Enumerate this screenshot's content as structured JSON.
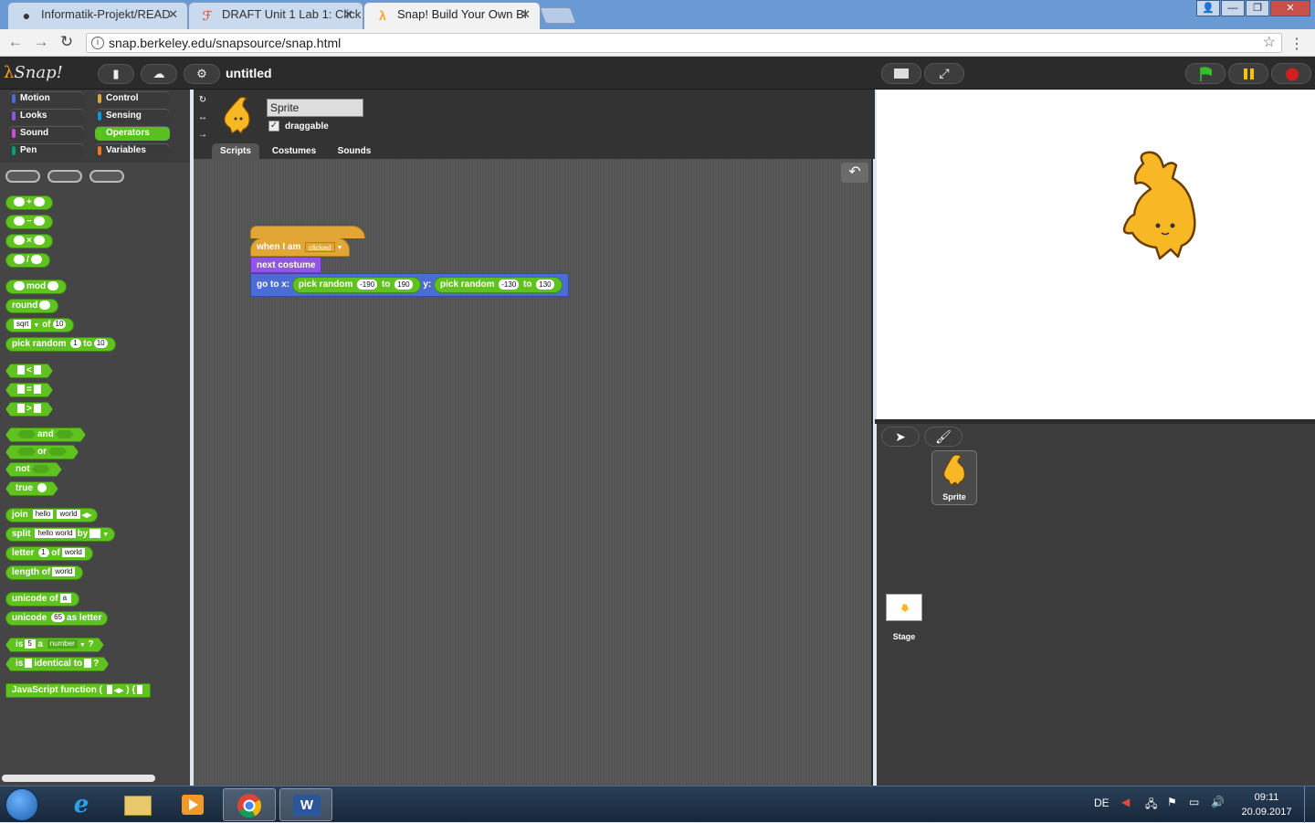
{
  "browser": {
    "tabs": [
      {
        "label": "Informatik-Projekt/READ",
        "icon": "github-icon",
        "active": false
      },
      {
        "label": "DRAFT Unit 1 Lab 1: Click",
        "icon": "bjc-icon",
        "active": false
      },
      {
        "label": "Snap! Build Your Own Bl",
        "icon": "snap-lambda-icon",
        "active": true
      }
    ],
    "url": "snap.berkeley.edu/snapsource/snap.html"
  },
  "snap": {
    "logo": "Snap!",
    "project_title": "untitled",
    "categories": [
      {
        "label": "Motion",
        "color": "#4a6cd4"
      },
      {
        "label": "Control",
        "color": "#e2a634"
      },
      {
        "label": "Looks",
        "color": "#8f56e3"
      },
      {
        "label": "Sensing",
        "color": "#0494dc"
      },
      {
        "label": "Sound",
        "color": "#cf4ad9"
      },
      {
        "label": "Operators",
        "color": "#5fc21e"
      },
      {
        "label": "Pen",
        "color": "#00a178"
      },
      {
        "label": "Variables",
        "color": "#f3761d"
      }
    ],
    "selected_category": "Operators",
    "palette": {
      "plus": "+",
      "minus": "−",
      "times": "×",
      "divide": "/",
      "mod": "mod",
      "round": "round",
      "sqrt_fn": "sqrt",
      "of": "of",
      "sqrt_val": "10",
      "pick_random": "pick random",
      "to": "to",
      "rand_from": "1",
      "rand_to": "10",
      "lt": "<",
      "eq": "=",
      "gt": ">",
      "and": "and",
      "or": "or",
      "not": "not",
      "true": "true",
      "join": "join",
      "join_a": "hello ",
      "join_b": "world",
      "split": "split",
      "split_val": "hello world",
      "by": "by",
      "split_by": " ",
      "letter": "letter",
      "letter_n": "1",
      "letter_of": "of",
      "letter_word": "world",
      "length": "length",
      "length_of": "of",
      "length_word": "world",
      "unicode_of": "unicode of",
      "unicode_of_val": "a",
      "unicode": "unicode",
      "unicode_num": "65",
      "as_letter": "as letter",
      "is": "is",
      "is_val": "5",
      "a": "a",
      "number": "number",
      "q": "?",
      "identical_to": "identical to",
      "js_function": "JavaScript function ( ",
      "js_braces": ") {"
    },
    "sprite": {
      "name": "Sprite",
      "draggable_label": "draggable",
      "draggable": true
    },
    "editor_tabs": [
      "Scripts",
      "Costumes",
      "Sounds"
    ],
    "selected_tab": "Scripts",
    "script": {
      "hat": "when I am",
      "hat_option": "clicked",
      "next_costume": "next costume",
      "goto": "go to x:",
      "y_label": "y:",
      "pick_random": "pick random",
      "to": "to",
      "x_from": "-190",
      "x_to": "190",
      "y_from": "-130",
      "y_to": "130"
    },
    "corral": {
      "sprite_label": "Sprite",
      "stage_label": "Stage"
    }
  },
  "taskbar": {
    "language": "DE",
    "time": "09:11",
    "date": "20.09.2017"
  }
}
